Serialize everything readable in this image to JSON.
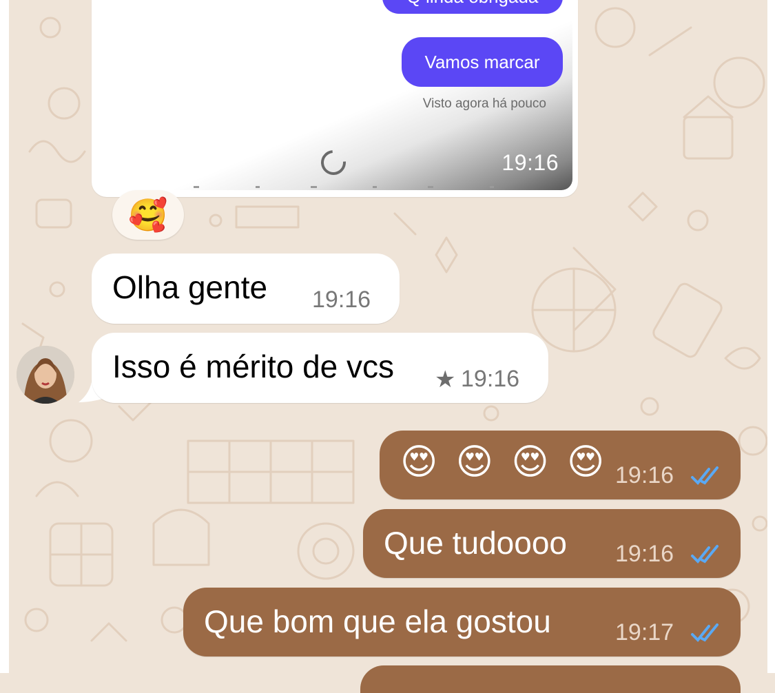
{
  "media_message": {
    "instagram_bubbles": [
      "Q linda obrigada",
      "Vamos marcar"
    ],
    "seen_text": "Visto agora há pouco",
    "time": "19:16"
  },
  "reaction_emoji": "🥰",
  "messages": [
    {
      "direction": "in",
      "text": "Olha gente",
      "time": "19:16",
      "starred": false
    },
    {
      "direction": "in",
      "text": "Isso é mérito de vcs",
      "time": "19:16",
      "starred": true
    },
    {
      "direction": "out",
      "text": "😍 😍 😍 😍",
      "time": "19:16",
      "read": true
    },
    {
      "direction": "out",
      "text": "Que tudoooo",
      "time": "19:16",
      "read": true
    },
    {
      "direction": "out",
      "text": "Que bom que ela gostou",
      "time": "19:17",
      "read": true
    }
  ],
  "icons": {
    "star": "★",
    "read_ticks": "double-check-icon",
    "loading": "spinner-icon"
  },
  "colors": {
    "wallpaper": "#efe4d8",
    "incoming_bubble": "#ffffff",
    "outgoing_bubble": "#9b6a46",
    "read_ticks": "#5aa9f4",
    "instagram_bubble": "#5b47f5"
  }
}
